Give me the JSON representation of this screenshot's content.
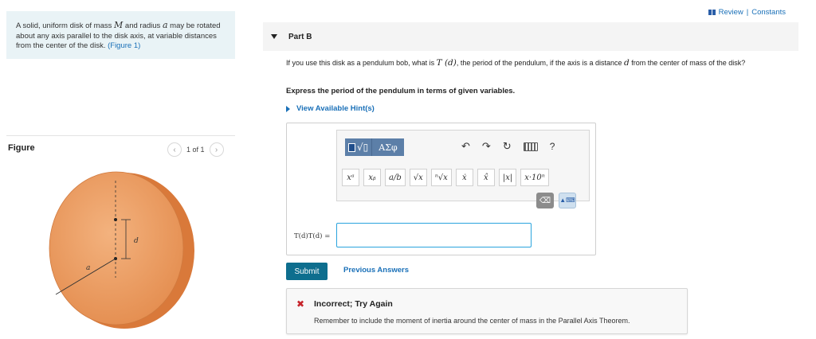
{
  "problem": {
    "text_before_M": "A solid, uniform disk of mass ",
    "var_M": "M",
    "text_before_a": " and radius ",
    "var_a": "a",
    "text_after": " may be rotated about any axis parallel to the disk axis, at variable distances from the center of the disk. ",
    "figure_link": "(Figure 1)"
  },
  "figure": {
    "title": "Figure",
    "pager_text": "1 of 1",
    "label_d": "d",
    "label_a": "a",
    "disk_color": "#e99a5e"
  },
  "header_links": {
    "review": "Review",
    "separator": "|",
    "constants": "Constants"
  },
  "part": {
    "title": "Part B"
  },
  "question": {
    "prefix": "If you use this disk as a pendulum bob, what is ",
    "T_d": "T (d)",
    "middle": ", the period of the pendulum, if the axis is a distance ",
    "d": "d",
    "suffix": " from the center of mass of the disk?"
  },
  "instruction": "Express the period of the pendulum in terms of given variables.",
  "hints_link": "View Available Hint(s)",
  "toolbar": {
    "greek_label": "ΑΣφ",
    "symbols": [
      "xᵃ",
      "xᵦ",
      "a/b",
      "√x",
      "ⁿ√x",
      "ẋ",
      "x̂",
      "|x|",
      "x·10ⁿ"
    ]
  },
  "answer": {
    "label": "T(d)T(d) =",
    "value": ""
  },
  "buttons": {
    "submit": "Submit",
    "previous_answers": "Previous Answers"
  },
  "feedback": {
    "title": "Incorrect; Try Again",
    "message": "Remember to include the moment of inertia around the center of mass in the Parallel Axis Theorem.",
    "status_color": "#c6242b"
  },
  "colors": {
    "link": "#1a70b8",
    "accent_button": "#0e6e8e",
    "input_border": "#2aa4dd"
  }
}
